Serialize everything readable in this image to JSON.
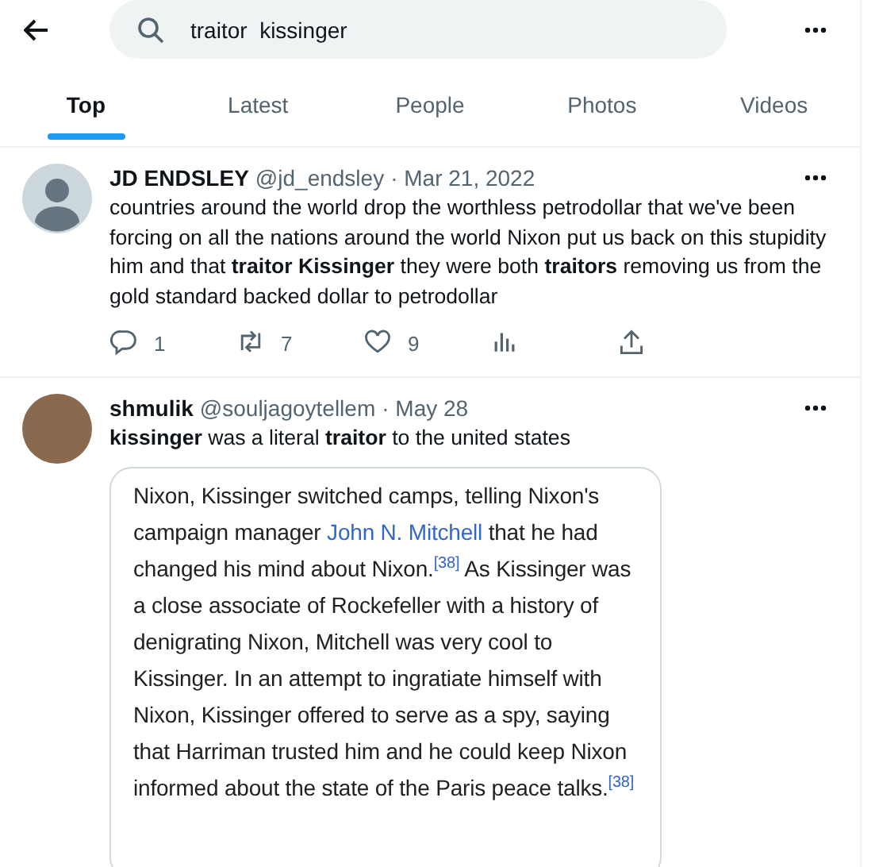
{
  "search": {
    "value": "traitor  kissinger"
  },
  "tabs": [
    {
      "label": "Top",
      "selected": true
    },
    {
      "label": "Latest",
      "selected": false
    },
    {
      "label": "People",
      "selected": false
    },
    {
      "label": "Photos",
      "selected": false
    },
    {
      "label": "Videos",
      "selected": false
    }
  ],
  "tweets": [
    {
      "kind": "silhouette",
      "name": "JD ENDSLEY",
      "handle": "@jd_endsley",
      "date": "· Mar 21, 2022",
      "text": "countries around the world drop the worthless petrodollar that we've been forcing on all the nations around the world Nixon put us back on this stupidity him and that **traitor Kissinger** they were both **traitors** removing us from the gold standard backed dollar to petrodollar",
      "actions": [
        {
          "kind": "reply",
          "count": "1"
        },
        {
          "kind": "retweet",
          "count": "7"
        },
        {
          "kind": "like",
          "count": "9"
        },
        {
          "kind": "views"
        },
        {
          "kind": "share"
        }
      ]
    },
    {
      "kind": "photo",
      "name": "shmulik",
      "handle": "@souljagoytellem",
      "date": "· May 28",
      "text": "**kissinger** was a literal **traitor** to the united states",
      "attachment": {
        "segments": [
          {
            "kind": "text",
            "text": "Nixon, Kissinger switched camps, telling Nixon's campaign manager "
          },
          {
            "kind": "link",
            "text": "John N. Mitchell"
          },
          {
            "kind": "text",
            "text": " that he had changed his mind about Nixon.$^{[38]}$ As Kissinger was a close associate of Rockefeller with a history of denigrating Nixon, Mitchell was very cool to Kissinger. In an attempt to ingratiate himself with Nixon, Kissinger offered to serve as a spy, saying that Harriman trusted him and he could keep Nixon informed about the state of the Paris peace talks.$^{[38]}$"
          }
        ]
      }
    }
  ]
}
